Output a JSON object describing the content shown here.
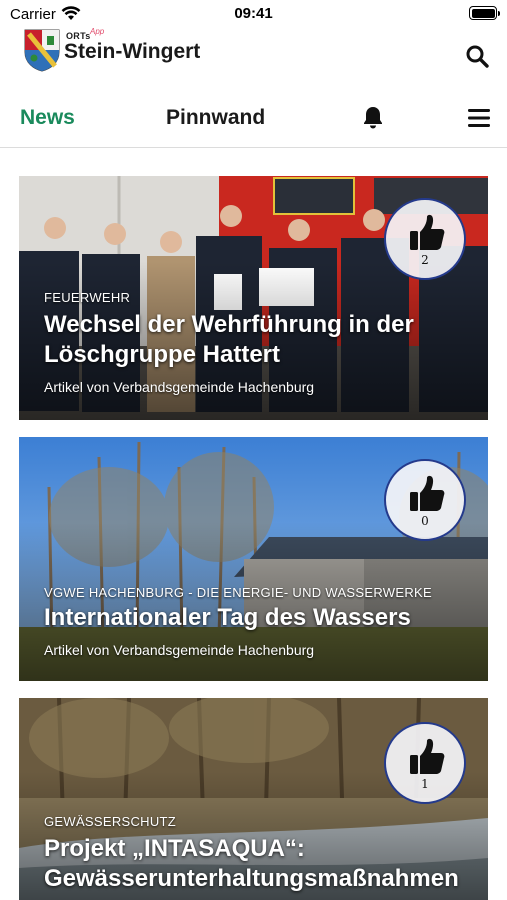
{
  "status_bar": {
    "carrier": "Carrier",
    "time": "09:41"
  },
  "header": {
    "logo_prefix": "ORTs",
    "logo_app": "App",
    "logo_name": "Stein-Wingert",
    "icons": {
      "crest": "municipal-crest",
      "search": "search-icon"
    }
  },
  "tabs": {
    "news": "News",
    "pinnwand": "Pinnwand",
    "active": "News",
    "icons": {
      "bell": "bell-icon",
      "menu": "hamburger-menu-icon"
    }
  },
  "colors": {
    "accent": "#1a8a5c",
    "like_ring": "#243a8c"
  },
  "articles": [
    {
      "category": "FEUERWEHR",
      "title": "Wechsel der Wehrführung in der Löschgruppe Hattert",
      "author": "Artikel von Verbandsgemeinde Hachenburg",
      "likes": "2"
    },
    {
      "category": "VGWE HACHENBURG - DIE ENERGIE- UND WASSERWERKE",
      "title": "Internationaler Tag des Wassers",
      "author": "Artikel von Verbandsgemeinde Hachenburg",
      "likes": "0"
    },
    {
      "category": "GEWÄSSERSCHUTZ",
      "title": "Projekt „INTASAQUA“: Gewässerunterhaltungsmaßnahmen",
      "author": "",
      "likes": "1"
    }
  ]
}
